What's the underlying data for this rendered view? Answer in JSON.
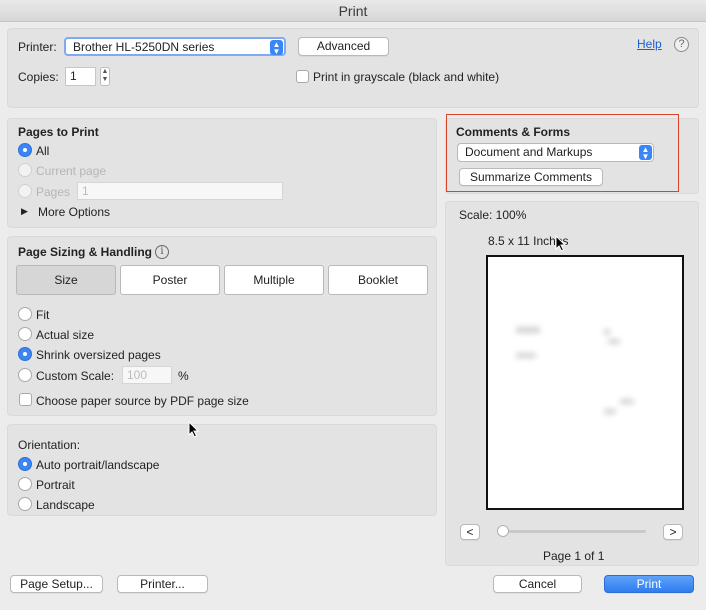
{
  "window": {
    "title": "Print"
  },
  "top": {
    "printer_label": "Printer:",
    "printer_value": "Brother HL-5250DN series",
    "advanced_button": "Advanced",
    "help_link": "Help",
    "help_icon": "?",
    "copies_label": "Copies:",
    "copies_value": "1",
    "grayscale_label": "Print in grayscale (black and white)"
  },
  "pages": {
    "heading": "Pages to Print",
    "all_label": "All",
    "current_label": "Current page",
    "pages_label": "Pages",
    "pages_value": "1",
    "more_options": "More Options",
    "selected": "all"
  },
  "sizing": {
    "heading": "Page Sizing & Handling",
    "info_icon": "i",
    "tabs": [
      "Size",
      "Poster",
      "Multiple",
      "Booklet"
    ],
    "selected_tab": "Size",
    "fit_label": "Fit",
    "actual_label": "Actual size",
    "shrink_label": "Shrink oversized pages",
    "custom_label": "Custom Scale:",
    "custom_value": "100",
    "percent": "%",
    "paper_source_label": "Choose paper source by PDF page size",
    "selected": "shrink"
  },
  "orientation": {
    "heading": "Orientation:",
    "auto_label": "Auto portrait/landscape",
    "portrait_label": "Portrait",
    "landscape_label": "Landscape",
    "selected": "auto"
  },
  "comments": {
    "heading": "Comments & Forms",
    "select_value": "Document and Markups",
    "summarize_button": "Summarize Comments",
    "highlight_color": "#d9442b"
  },
  "preview": {
    "scale": "Scale: 100%",
    "paper_size": "8.5 x 11 Inches",
    "prev": "<",
    "next": ">",
    "page_info": "Page 1 of 1"
  },
  "footer": {
    "page_setup": "Page Setup...",
    "printer": "Printer...",
    "cancel": "Cancel",
    "print": "Print"
  },
  "colors": {
    "accent": "#3b86f7"
  }
}
